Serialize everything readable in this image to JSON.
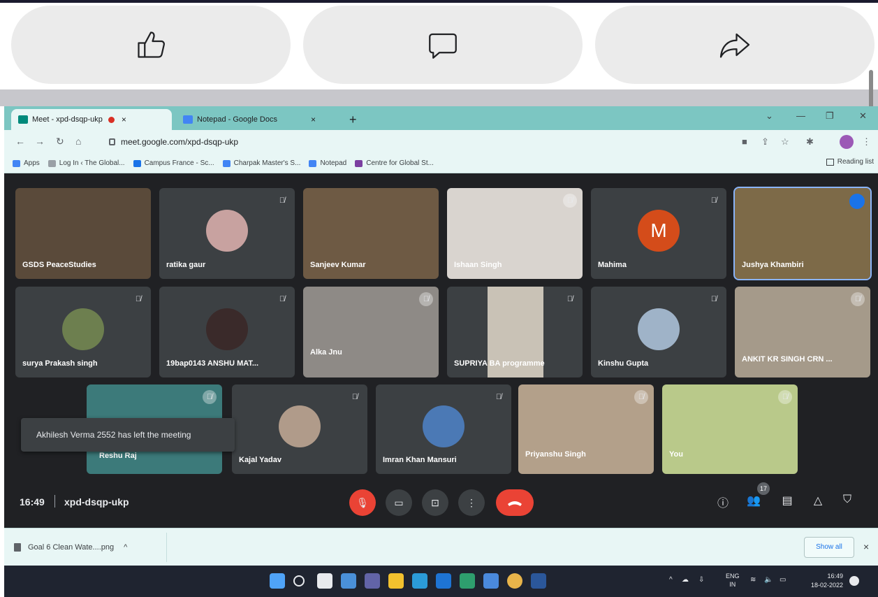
{
  "browser": {
    "tabs": [
      {
        "label": "Meet - xpd-dsqp-ukp",
        "close": "×"
      },
      {
        "label": "Notepad - Google Docs",
        "close": "×"
      }
    ],
    "new_tab": "+",
    "url": "meet.google.com/xpd-dsqp-ukp",
    "bookmarks": [
      {
        "label": "Apps",
        "color": "#4285f4"
      },
      {
        "label": "Log In ‹ The Global...",
        "color": "#9aa0a6"
      },
      {
        "label": "Campus France - Sc...",
        "color": "#1a73e8"
      },
      {
        "label": "Charpak Master's S...",
        "color": "#4285f4"
      },
      {
        "label": "Notepad",
        "color": "#4285f4"
      },
      {
        "label": "Centre for Global St...",
        "color": "#7b3fa0"
      }
    ],
    "reading_list": "Reading list"
  },
  "meet": {
    "tiles": [
      {
        "name": "GSDS PeaceStudies",
        "type": "video",
        "color": "#5a4a3a"
      },
      {
        "name": "ratika gaur",
        "type": "avatar",
        "avatar_color": "#c8a2a0"
      },
      {
        "name": "Sanjeev Kumar",
        "type": "video",
        "color": "#6e5a44"
      },
      {
        "name": "Ishaan Singh",
        "type": "video",
        "color": "#d9d4cf"
      },
      {
        "name": "Mahima",
        "type": "letter",
        "letter": "M"
      },
      {
        "name": "Jushya Khambiri",
        "type": "video",
        "color": "#7d6a48"
      },
      {
        "name": "surya Prakash singh",
        "type": "avatar",
        "avatar_color": "#6d7f4f"
      },
      {
        "name": "19bap0143 ANSHU MAT...",
        "type": "avatar",
        "avatar_color": "#3a2a2a"
      },
      {
        "name": "Alka Jnu",
        "type": "video",
        "color": "#8e8a86"
      },
      {
        "name": "SUPRIYA BA programme",
        "type": "video",
        "color": "#c9c2b6"
      },
      {
        "name": "Kinshu Gupta",
        "type": "avatar",
        "avatar_color": "#9fb3c8"
      },
      {
        "name": "ANKIT KR SINGH CRN ...",
        "type": "video",
        "color": "#a59a8a"
      },
      {
        "name": "Reshu Raj",
        "type": "video",
        "color": "#3c7a7a"
      },
      {
        "name": "Kajal Yadav",
        "type": "avatar",
        "avatar_color": "#b09b8a"
      },
      {
        "name": "Imran Khan Mansuri",
        "type": "avatar",
        "avatar_color": "#4b79b5"
      },
      {
        "name": "Priyanshu Singh",
        "type": "video",
        "color": "#b3a08a"
      },
      {
        "name": "You",
        "type": "video",
        "color": "#b9c98a"
      }
    ],
    "toast": "Akhilesh Verma 2552 has left the meeting",
    "time": "16:49",
    "meeting_code": "xpd-dsqp-ukp",
    "participant_count": "17"
  },
  "downloads": {
    "file": "Goal 6 Clean Wate....png",
    "show_all": "Show all",
    "close": "×"
  },
  "taskbar": {
    "lang_line1": "ENG",
    "lang_line2": "IN",
    "time": "16:49",
    "date": "18-02-2022"
  }
}
